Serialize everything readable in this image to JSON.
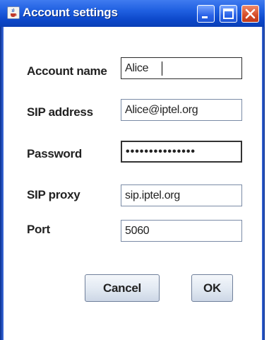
{
  "window": {
    "title": "Account settings",
    "title_icon": "java-cup-icon",
    "controls": [
      "minimize-icon",
      "maximize-icon",
      "close-icon"
    ]
  },
  "form": {
    "account_name": {
      "label": "Account name",
      "value": "Alice"
    },
    "sip_address": {
      "label": "SIP address",
      "value": "Alice@iptel.org"
    },
    "password": {
      "label": "Password",
      "value": "•••••••••••••••"
    },
    "sip_proxy": {
      "label": "SIP proxy",
      "value": "sip.iptel.org"
    },
    "port": {
      "label": "Port",
      "value": "5060"
    }
  },
  "buttons": {
    "cancel": "Cancel",
    "ok": "OK"
  },
  "colors": {
    "titlebar": "#1f5fe0",
    "close_button": "#d54c28",
    "button_face": "#e3eaf3"
  }
}
